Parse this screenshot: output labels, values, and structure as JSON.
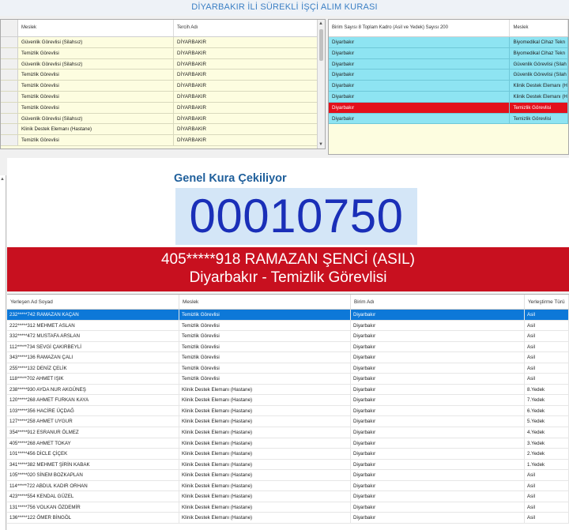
{
  "app_title": "DİYARBAKIR İLİ SÜREKLİ İŞÇİ ALIM KURASI",
  "left_grid": {
    "headers": [
      "Meslek",
      "Tercih Adı"
    ],
    "rows": [
      [
        "Güvenlik Görevlisi (Silahsız)",
        "DİYARBAKIR"
      ],
      [
        "Temizlik Görevlisi",
        "DİYARBAKIR"
      ],
      [
        "Güvenlik Görevlisi (Silahsız)",
        "DİYARBAKIR"
      ],
      [
        "Temizlik Görevlisi",
        "DİYARBAKIR"
      ],
      [
        "Temizlik Görevlisi",
        "DİYARBAKIR"
      ],
      [
        "Temizlik Görevlisi",
        "DİYARBAKIR"
      ],
      [
        "Temizlik Görevlisi",
        "DİYARBAKIR"
      ],
      [
        "Güvenlik Görevlisi (Silahsız)",
        "DİYARBAKIR"
      ],
      [
        "Klinik Destek Elemanı (Hastane)",
        "DİYARBAKIR"
      ],
      [
        "Temizlik Görevlisi",
        "DİYARBAKIR"
      ]
    ]
  },
  "right_grid": {
    "headers": [
      "Birim Sayısı 8 Toplam Kadro (Asil ve Yedek) Sayısı 200",
      "Meslek"
    ],
    "rows": [
      [
        "Diyarbakır",
        "Biyomedikal Cihaz Tekn"
      ],
      [
        "Diyarbakır",
        "Biyomedikal Cihaz Tekn"
      ],
      [
        "Diyarbakır",
        "Güvenlik Görevlisi (Silah"
      ],
      [
        "Diyarbakır",
        "Güvenlik Görevlisi (Silah"
      ],
      [
        "Diyarbakır",
        "Klinik Destek Elemanı (H"
      ],
      [
        "Diyarbakır",
        "Klinik Destek Elemanı (H"
      ],
      [
        "Diyarbakır",
        "Temizlik Görevlisi"
      ],
      [
        "Diyarbakır",
        "Temizlik Görevlisi"
      ]
    ],
    "highlight_row": 6,
    "colors": {
      "row_bg": "#8ee4f2",
      "highlight_bg": "#e3101b"
    }
  },
  "draw": {
    "label": "Genel Kura Çekiliyor",
    "number": "00010750",
    "result_line1": "405*****918 RAMAZAN ŞENCİ (ASIL)",
    "result_line2": "Diyarbakır - Temizlik Görevlisi",
    "colors": {
      "banner": "#c8101f",
      "number": "#1a2fb8",
      "number_bg": "#d4e6f7"
    }
  },
  "bottom_grid": {
    "headers": [
      "Yerleşen Ad Soyad",
      "Meslek",
      "Birim Adı",
      "Yerleştirme Türü"
    ],
    "selected_row": 0,
    "rows": [
      [
        "232*****742 RAMAZAN KAÇAN",
        "Temizlik Görevlisi",
        "Diyarbakır",
        "Asil"
      ],
      [
        "222*****312 MEHMET ASLAN",
        "Temizlik Görevlisi",
        "Diyarbakır",
        "Asil"
      ],
      [
        "332*****472 MUSTAFA ARSLAN",
        "Temizlik Görevlisi",
        "Diyarbakır",
        "Asil"
      ],
      [
        "112*****734 SEVGİ ÇAKIRBEYLİ",
        "Temizlik Görevlisi",
        "Diyarbakır",
        "Asil"
      ],
      [
        "343*****136 RAMAZAN ÇALI",
        "Temizlik Görevlisi",
        "Diyarbakır",
        "Asil"
      ],
      [
        "255*****132 DENİZ ÇELİK",
        "Temizlik Görevlisi",
        "Diyarbakır",
        "Asil"
      ],
      [
        "118*****702 AHMET IŞIK",
        "Temizlik Görevlisi",
        "Diyarbakır",
        "Asil"
      ],
      [
        "238*****930 AYDA NUR AKGÜNEŞ",
        "Klinik Destek Elemanı (Hastane)",
        "Diyarbakır",
        "8.Yedek"
      ],
      [
        "120*****268 AHMET FURKAN KAYA",
        "Klinik Destek Elemanı (Hastane)",
        "Diyarbakır",
        "7.Yedek"
      ],
      [
        "103*****356 HACİRE ÜÇDAĞ",
        "Klinik Destek Elemanı (Hastane)",
        "Diyarbakır",
        "6.Yedek"
      ],
      [
        "127*****258 AHMET UYGUR",
        "Klinik Destek Elemanı (Hastane)",
        "Diyarbakır",
        "5.Yedek"
      ],
      [
        "354*****912 ESRANUR ÖLMEZ",
        "Klinik Destek Elemanı (Hastane)",
        "Diyarbakır",
        "4.Yedek"
      ],
      [
        "405*****268 AHMET TOKAY",
        "Klinik Destek Elemanı (Hastane)",
        "Diyarbakır",
        "3.Yedek"
      ],
      [
        "101*****456 DİCLE ÇİÇEK",
        "Klinik Destek Elemanı (Hastane)",
        "Diyarbakır",
        "2.Yedek"
      ],
      [
        "341*****382 MEHMET ŞİRİN KABAK",
        "Klinik Destek Elemanı (Hastane)",
        "Diyarbakır",
        "1.Yedek"
      ],
      [
        "105*****020 SİNEM BOZKAPLAN",
        "Klinik Destek Elemanı (Hastane)",
        "Diyarbakır",
        "Asil"
      ],
      [
        "114*****722 ABDUL KADIR ORHAN",
        "Klinik Destek Elemanı (Hastane)",
        "Diyarbakır",
        "Asil"
      ],
      [
        "423*****554 KENDAL GÜZEL",
        "Klinik Destek Elemanı (Hastane)",
        "Diyarbakır",
        "Asil"
      ],
      [
        "131*****756 VOLKAN ÖZDEMİR",
        "Klinik Destek Elemanı (Hastane)",
        "Diyarbakır",
        "Asil"
      ],
      [
        "136*****122 ÖMER BİNGÖL",
        "Klinik Destek Elemanı (Hastane)",
        "Diyarbakır",
        "Asil"
      ]
    ],
    "colors": {
      "selected_bg": "#0d78d8"
    }
  }
}
